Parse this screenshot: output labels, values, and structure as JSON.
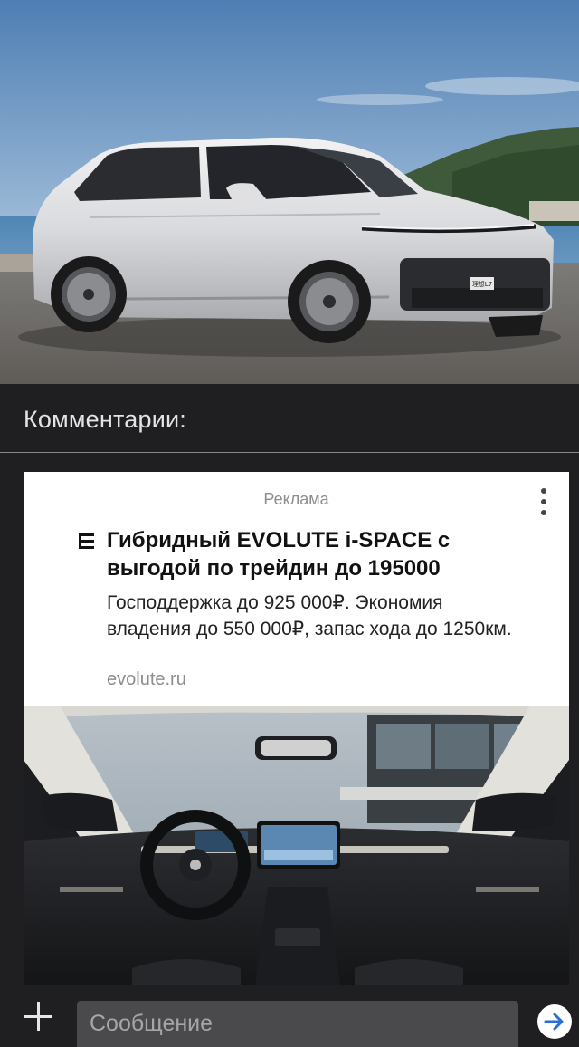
{
  "hero": {
    "image": "white-suv-on-coastal-road",
    "plate_text": "理想L7"
  },
  "comments": {
    "title": "Комментарии:"
  },
  "ad": {
    "label": "Реклама",
    "menu_icon": "more-vertical-icon",
    "logo_icon": "evolute-logo-icon",
    "title": "Гибридный EVOLUTE i-SPACE с выгодой по трейдин до 195000",
    "description": "Господдержка до 925 000₽. Экономия владения до 550 000₽, запас хода до 1250км.",
    "domain": "evolute.ru",
    "image": "car-interior-dashboard"
  },
  "composer": {
    "add_icon": "plus-icon",
    "placeholder": "Сообщение",
    "send_icon": "arrow-right-icon"
  },
  "colors": {
    "background": "#1f1f21",
    "divider": "#8a8a8a",
    "input_bg": "#4a4a4c",
    "send_arrow": "#2b6fd6"
  }
}
